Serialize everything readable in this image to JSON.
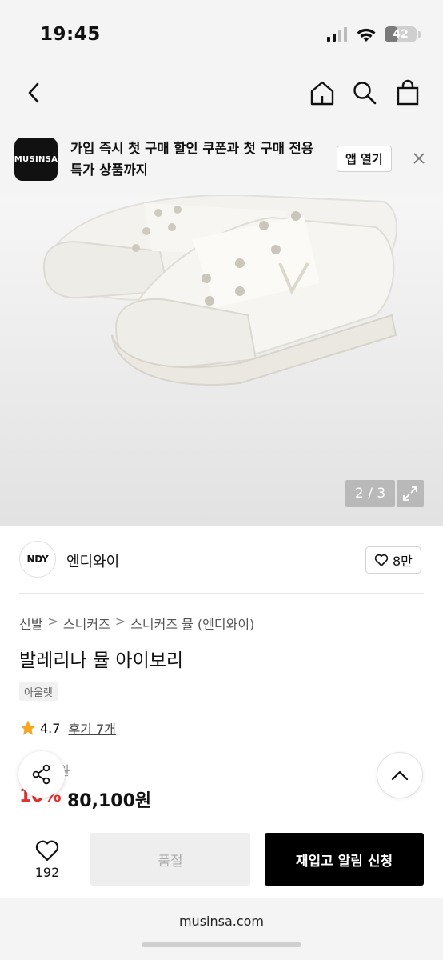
{
  "status_bar": {
    "time": "19:45",
    "battery_level": "42"
  },
  "app_banner": {
    "logo_text": "MUSINSA",
    "message": "가입 즉시 첫 구매 할인 쿠폰과 첫 구매 전용 특가 상품까지",
    "open_button": "앱 열기"
  },
  "gallery": {
    "counter": "2 / 3"
  },
  "brand": {
    "logo_text": "NDY",
    "name": "엔디와이",
    "likes": "8만"
  },
  "breadcrumb": [
    "신발",
    "스니커즈",
    "스니커즈 뮬 (엔디와이)"
  ],
  "breadcrumb_separator": ">",
  "product": {
    "title": "발레리나 뮬 아이보리",
    "badge": "아울렛",
    "rating": "4.7",
    "reviews": "후기 7개",
    "original_price": "0원",
    "discount": "10%",
    "price": "80,100원"
  },
  "bottom_bar": {
    "wish_count": "192",
    "soldout_label": "품절",
    "restock_label": "재입고 알림 신청"
  },
  "browser": {
    "url": "musinsa.com"
  },
  "colors": {
    "discount_red": "#e2312f",
    "star": "#f5a623"
  }
}
